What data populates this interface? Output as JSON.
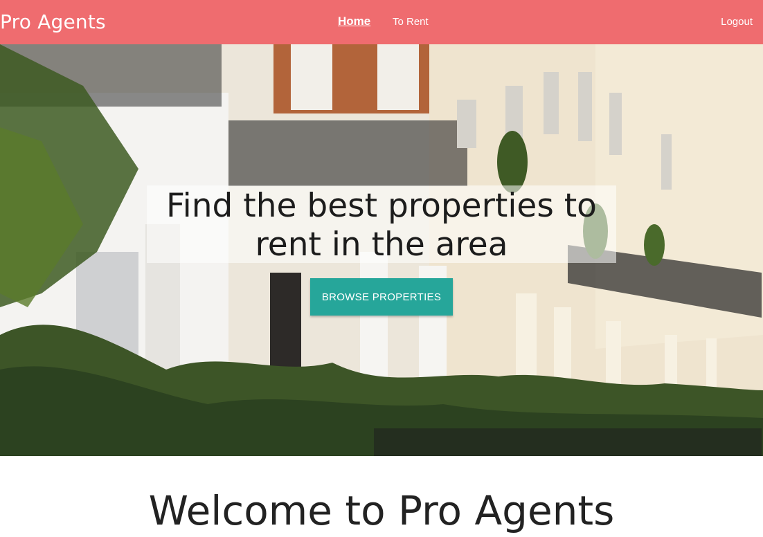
{
  "nav": {
    "brand": "Pro Agents",
    "links": [
      {
        "label": "Home",
        "active": true
      },
      {
        "label": "To Rent",
        "active": false
      }
    ],
    "logout": "Logout",
    "color": "#ef6c6f"
  },
  "hero": {
    "headline_line1": "Find the best properties to",
    "headline_line2": "rent in the area",
    "button_label": "BROWSE PROPERTIES",
    "button_color": "#26a69a"
  },
  "welcome": {
    "title": "Welcome to Pro Agents"
  }
}
